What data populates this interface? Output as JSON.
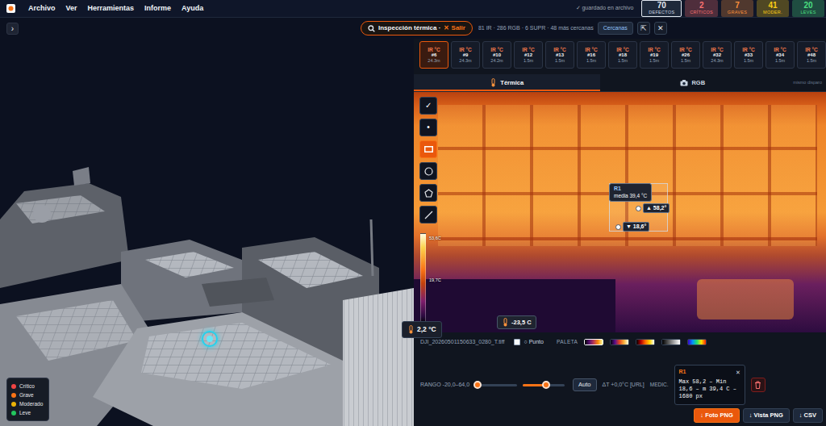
{
  "menu": {
    "items": [
      "Archivo",
      "Ver",
      "Herramientas",
      "Informe",
      "Ayuda"
    ]
  },
  "save_status": "✓ guardado en archivo",
  "stats": [
    {
      "value": "70",
      "label": "DEFECTOS",
      "selected": true,
      "color": "#e2e8f0"
    },
    {
      "value": "2",
      "label": "CRÍTICOS",
      "selected": false,
      "color": "#f87171"
    },
    {
      "value": "7",
      "label": "GRAVES",
      "selected": false,
      "color": "#fb923c"
    },
    {
      "value": "41",
      "label": "MODER.",
      "selected": false,
      "color": "#facc15"
    },
    {
      "value": "20",
      "label": "LEVES",
      "selected": false,
      "color": "#4ade80"
    }
  ],
  "viewport": {
    "toggle": "›",
    "legend": [
      {
        "label": "Crítico",
        "color": "#ef4444"
      },
      {
        "label": "Grave",
        "color": "#f97316"
      },
      {
        "label": "Moderado",
        "color": "#eab308"
      },
      {
        "label": "Leve",
        "color": "#22c55e"
      }
    ],
    "hover_reading": "2,2 °C"
  },
  "inspection": {
    "title": "Inspección térmica ·",
    "exit": "✕ Salir",
    "counts": "81 IR · 286 RGB · 6 SUPR · 48 más cercanas",
    "nearby_button": "Cercanas",
    "collapse_button": "⇱",
    "close_button": "✕"
  },
  "thumbnails": [
    {
      "label": "IR °C",
      "id": "#6",
      "distance": "24.3m",
      "selected": true
    },
    {
      "label": "IR °C",
      "id": "#9",
      "distance": "24.3m",
      "selected": false
    },
    {
      "label": "IR °C",
      "id": "#10",
      "distance": "24.2m",
      "selected": false
    },
    {
      "label": "IR °C",
      "id": "#12",
      "distance": "1.5m",
      "selected": false
    },
    {
      "label": "IR °C",
      "id": "#13",
      "distance": "1.5m",
      "selected": false
    },
    {
      "label": "IR °C",
      "id": "#16",
      "distance": "1.5m",
      "selected": false
    },
    {
      "label": "IR °C",
      "id": "#18",
      "distance": "1.5m",
      "selected": false
    },
    {
      "label": "IR °C",
      "id": "#19",
      "distance": "1.5m",
      "selected": false
    },
    {
      "label": "IR °C",
      "id": "#26",
      "distance": "1.5m",
      "selected": false
    },
    {
      "label": "IR °C",
      "id": "#32",
      "distance": "24.3m",
      "selected": false
    },
    {
      "label": "IR °C",
      "id": "#33",
      "distance": "1.5m",
      "selected": false
    },
    {
      "label": "IR °C",
      "id": "#34",
      "distance": "1.5m",
      "selected": false
    },
    {
      "label": "IR °C",
      "id": "#48",
      "distance": "1.5m",
      "selected": false
    }
  ],
  "tabs": [
    {
      "label": "Térmica",
      "selected": true
    },
    {
      "label": "RGB",
      "selected": false
    }
  ],
  "tabs_note": "mismo disparo",
  "tools": [
    {
      "kind": "confirm",
      "glyph": "✓",
      "selected": false
    },
    {
      "kind": "point",
      "glyph": "•",
      "selected": false
    },
    {
      "kind": "rectangle",
      "selected": true
    },
    {
      "kind": "circle",
      "selected": false
    },
    {
      "kind": "polygon",
      "selected": false
    },
    {
      "kind": "line",
      "selected": false
    }
  ],
  "scale": {
    "labels": [
      "53,6C",
      "19,7C"
    ]
  },
  "region": {
    "name": "R1",
    "mean": "media 39,4 °C",
    "max": "▲ 58,2°",
    "min": "▼ 18,6°"
  },
  "cursor_reading": "-23,5 C",
  "file": {
    "name": "DJI_20260501150633_0280_T.tiff",
    "point": {
      "label": "○ Punto",
      "checked": false
    },
    "palette_label": "PALETA",
    "palettes": [
      {
        "colors": [
          "#000004",
          "#57106e",
          "#bc3754",
          "#f98e09",
          "#fcffa4"
        ],
        "selected": true
      },
      {
        "colors": [
          "#00000a",
          "#5b0f8a",
          "#e3461e",
          "#fbb03b",
          "#ffffe0"
        ],
        "selected": false
      },
      {
        "colors": [
          "#000000",
          "#b00000",
          "#ff6a00",
          "#ffd200",
          "#ffffff"
        ],
        "selected": false
      },
      {
        "colors": [
          "#000000",
          "#ffffff"
        ],
        "selected": false
      },
      {
        "colors": [
          "#3b00c8",
          "#0090ff",
          "#20e070",
          "#ffe000",
          "#ff2000"
        ],
        "selected": false
      }
    ]
  },
  "range": {
    "label": "RANGO -20,0–64,0",
    "sliders": [
      {
        "level": 0.05
      },
      {
        "level": 0.55
      }
    ],
    "auto_button": "Auto",
    "delta": "ΔT +0,0°C [URL]",
    "measure_label": "MEDIC."
  },
  "measurement": {
    "name": "R1",
    "text": "Max 58,2 – Min 18,6 – m 39,4 C – 1680 px",
    "close": "✕"
  },
  "exports": [
    {
      "label": "↓ Foto PNG",
      "primary": true
    },
    {
      "label": "↓ Vista PNG",
      "primary": false
    },
    {
      "label": "↓ CSV",
      "primary": false
    }
  ]
}
